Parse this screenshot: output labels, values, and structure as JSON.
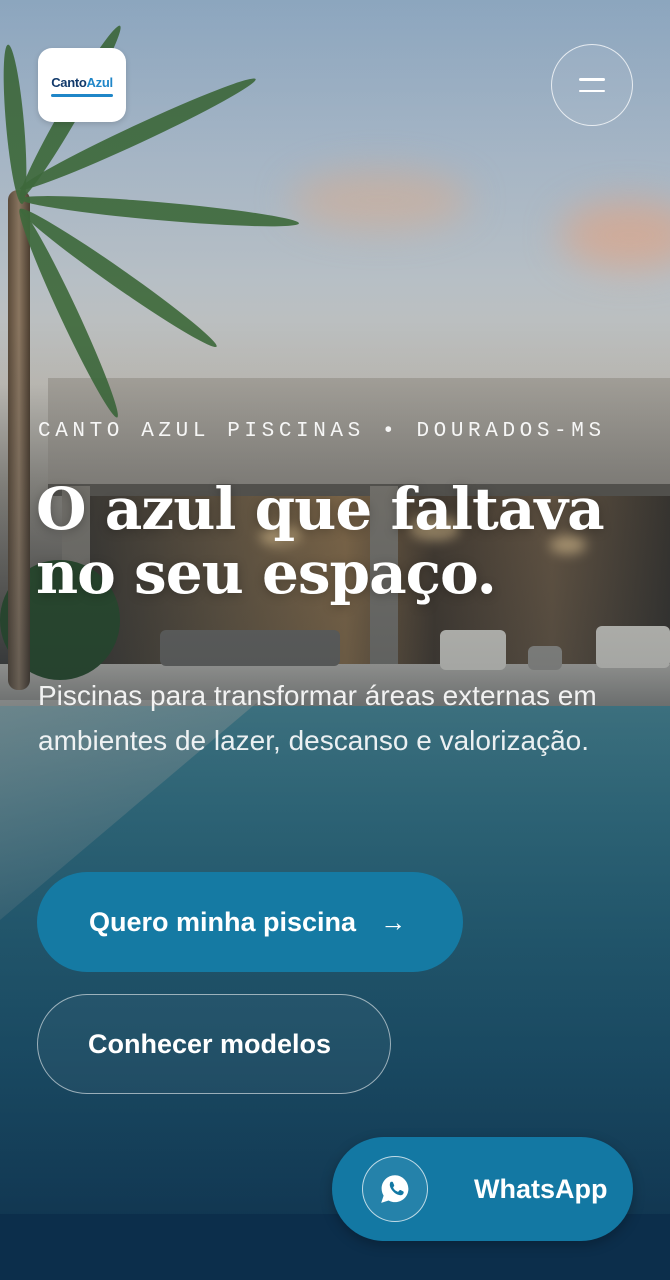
{
  "header": {
    "logo_text_1": "Canto",
    "logo_text_2": "Azul",
    "menu_icon": "hamburger-menu-icon"
  },
  "hero": {
    "eyebrow": "CANTO AZUL PISCINAS • DOURADOS-MS",
    "headline_line1": "O azul que faltava",
    "headline_line2": "no seu espaço.",
    "subtitle": "Piscinas para transformar áreas externas em ambientes de lazer, descanso e valorização.",
    "primary_cta": "Quero minha piscina",
    "primary_cta_icon": "arrow-right-icon",
    "secondary_cta": "Conhecer modelos"
  },
  "floating": {
    "whatsapp_label": "WhatsApp",
    "whatsapp_icon": "whatsapp-icon"
  },
  "colors": {
    "primary": "#157aa3",
    "footer": "#0c2e4b",
    "brand_dark": "#123a6b",
    "brand_light": "#1f86c8"
  }
}
